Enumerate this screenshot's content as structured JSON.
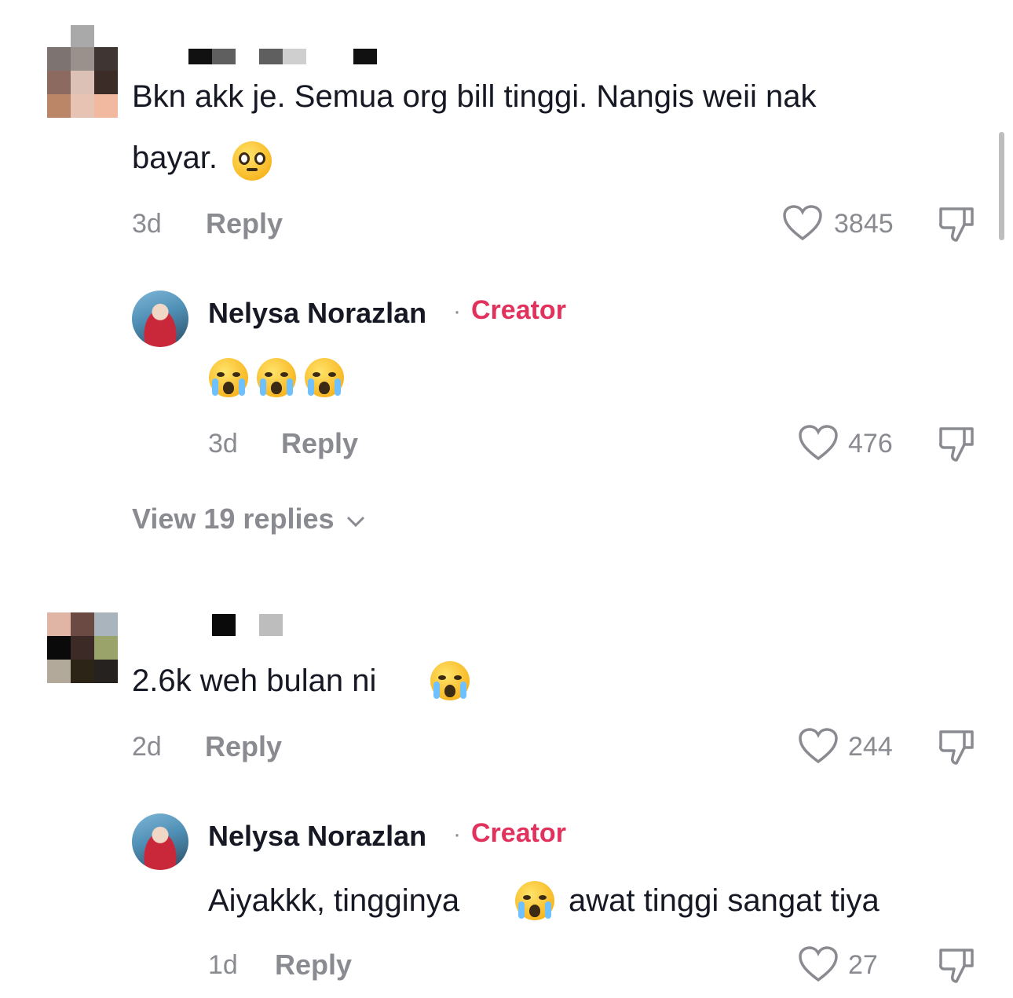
{
  "comments": [
    {
      "text_line1": "Bkn akk je. Semua org bill tinggi. Nangis weii nak",
      "text_line2": "bayar.",
      "emoji": "pleading-face",
      "time": "3d",
      "reply_label": "Reply",
      "likes": "3845",
      "reply": {
        "author": "Nelysa Norazlan",
        "separator": "·",
        "badge": "Creator",
        "emoji": "loudly-crying-face x3",
        "time": "3d",
        "reply_label": "Reply",
        "likes": "476"
      },
      "view_replies": "View 19 replies"
    },
    {
      "text": "2.6k weh bulan ni",
      "emoji": "loudly-crying-face",
      "time": "2d",
      "reply_label": "Reply",
      "likes": "244",
      "reply": {
        "author": "Nelysa Norazlan",
        "separator": "·",
        "badge": "Creator",
        "text_before": "Aiyakkk, tingginya",
        "emoji": "loudly-crying-face",
        "text_after": "awat tinggi sangat tiya",
        "time": "1d",
        "reply_label": "Reply",
        "likes": "27"
      }
    }
  ],
  "colors": {
    "text": "#161823",
    "muted": "#8a8b91",
    "creator": "#e0325d"
  }
}
